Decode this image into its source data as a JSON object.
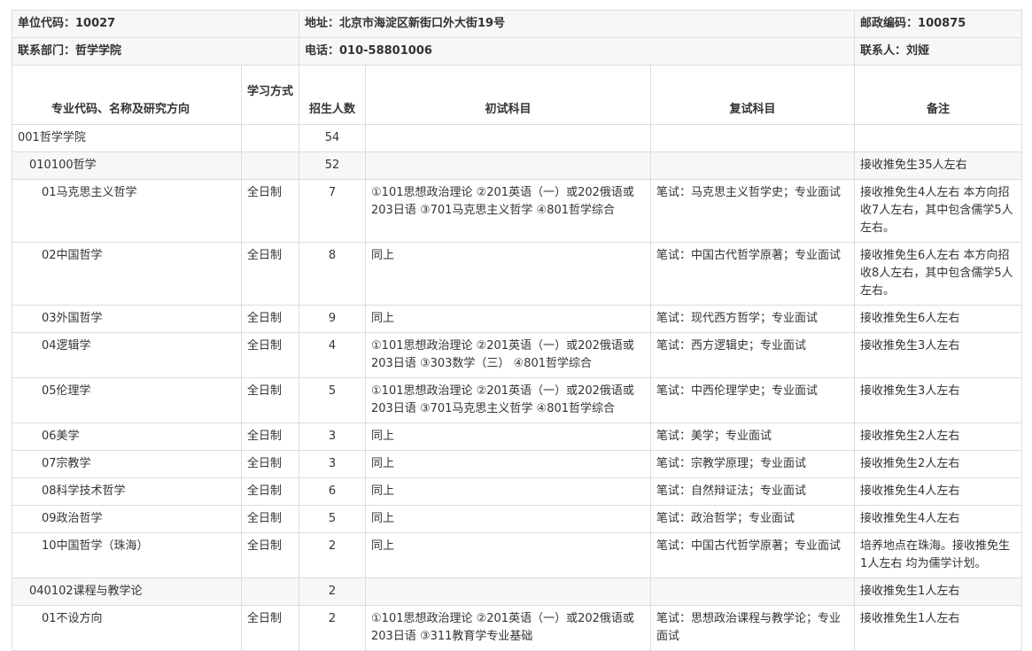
{
  "info": {
    "unit_code": "单位代码：10027",
    "address": "地址：北京市海淀区新街口外大街19号",
    "postcode": "邮政编码：100875",
    "department": "联系部门：哲学学院",
    "phone": "电话：010-58801006",
    "contact": "联系人：刘娅"
  },
  "headers": {
    "major": "专业代码、名称及研究方向",
    "mode": "学习方式",
    "quota": "招生人数",
    "first_exam": "初试科目",
    "retest": "复试科目",
    "notes": "备注"
  },
  "rows": [
    {
      "name": "001哲学学院",
      "mode": "",
      "quota": "54",
      "first": "",
      "retest": "",
      "note": ""
    },
    {
      "name": "010100哲学",
      "mode": "",
      "quota": "52",
      "first": "",
      "retest": "",
      "note": "接收推免生35人左右"
    },
    {
      "name": "01马克思主义哲学",
      "mode": "全日制",
      "quota": "7",
      "first": "①101思想政治理论 ②201英语（一）或202俄语或203日语 ③701马克思主义哲学 ④801哲学综合",
      "retest": "笔试：马克思主义哲学史；专业面试",
      "note": "接收推免生4人左右 本方向招收7人左右，其中包含儒学5人左右。"
    },
    {
      "name": "02中国哲学",
      "mode": "全日制",
      "quota": "8",
      "first": "同上",
      "retest": "笔试：中国古代哲学原著；专业面试",
      "note": "接收推免生6人左右 本方向招收8人左右，其中包含儒学5人左右。"
    },
    {
      "name": "03外国哲学",
      "mode": "全日制",
      "quota": "9",
      "first": "同上",
      "retest": "笔试：现代西方哲学；专业面试",
      "note": "接收推免生6人左右"
    },
    {
      "name": "04逻辑学",
      "mode": "全日制",
      "quota": "4",
      "first": "①101思想政治理论 ②201英语（一）或202俄语或203日语 ③303数学（三） ④801哲学综合",
      "retest": "笔试：西方逻辑史；专业面试",
      "note": "接收推免生3人左右"
    },
    {
      "name": "05伦理学",
      "mode": "全日制",
      "quota": "5",
      "first": "①101思想政治理论 ②201英语（一）或202俄语或203日语 ③701马克思主义哲学 ④801哲学综合",
      "retest": "笔试：中西伦理学史；专业面试",
      "note": "接收推免生3人左右"
    },
    {
      "name": "06美学",
      "mode": "全日制",
      "quota": "3",
      "first": "同上",
      "retest": "笔试：美学；专业面试",
      "note": "接收推免生2人左右"
    },
    {
      "name": "07宗教学",
      "mode": "全日制",
      "quota": "3",
      "first": "同上",
      "retest": "笔试：宗教学原理；专业面试",
      "note": "接收推免生2人左右"
    },
    {
      "name": "08科学技术哲学",
      "mode": "全日制",
      "quota": "6",
      "first": "同上",
      "retest": "笔试：自然辩证法；专业面试",
      "note": "接收推免生4人左右"
    },
    {
      "name": "09政治哲学",
      "mode": "全日制",
      "quota": "5",
      "first": "同上",
      "retest": "笔试：政治哲学；专业面试",
      "note": "接收推免生4人左右"
    },
    {
      "name": "10中国哲学（珠海）",
      "mode": "全日制",
      "quota": "2",
      "first": "同上",
      "retest": "笔试：中国古代哲学原著；专业面试",
      "note": "培养地点在珠海。接收推免生1人左右 均为儒学计划。"
    },
    {
      "name": "040102课程与教学论",
      "mode": "",
      "quota": "2",
      "first": "",
      "retest": "",
      "note": "接收推免生1人左右"
    },
    {
      "name": "01不设方向",
      "mode": "全日制",
      "quota": "2",
      "first": "①101思想政治理论 ②201英语（一）或202俄语或203日语 ③311教育学专业基础",
      "retest": "笔试：思想政治课程与教学论；专业面试",
      "note": "接收推免生1人左右"
    }
  ]
}
